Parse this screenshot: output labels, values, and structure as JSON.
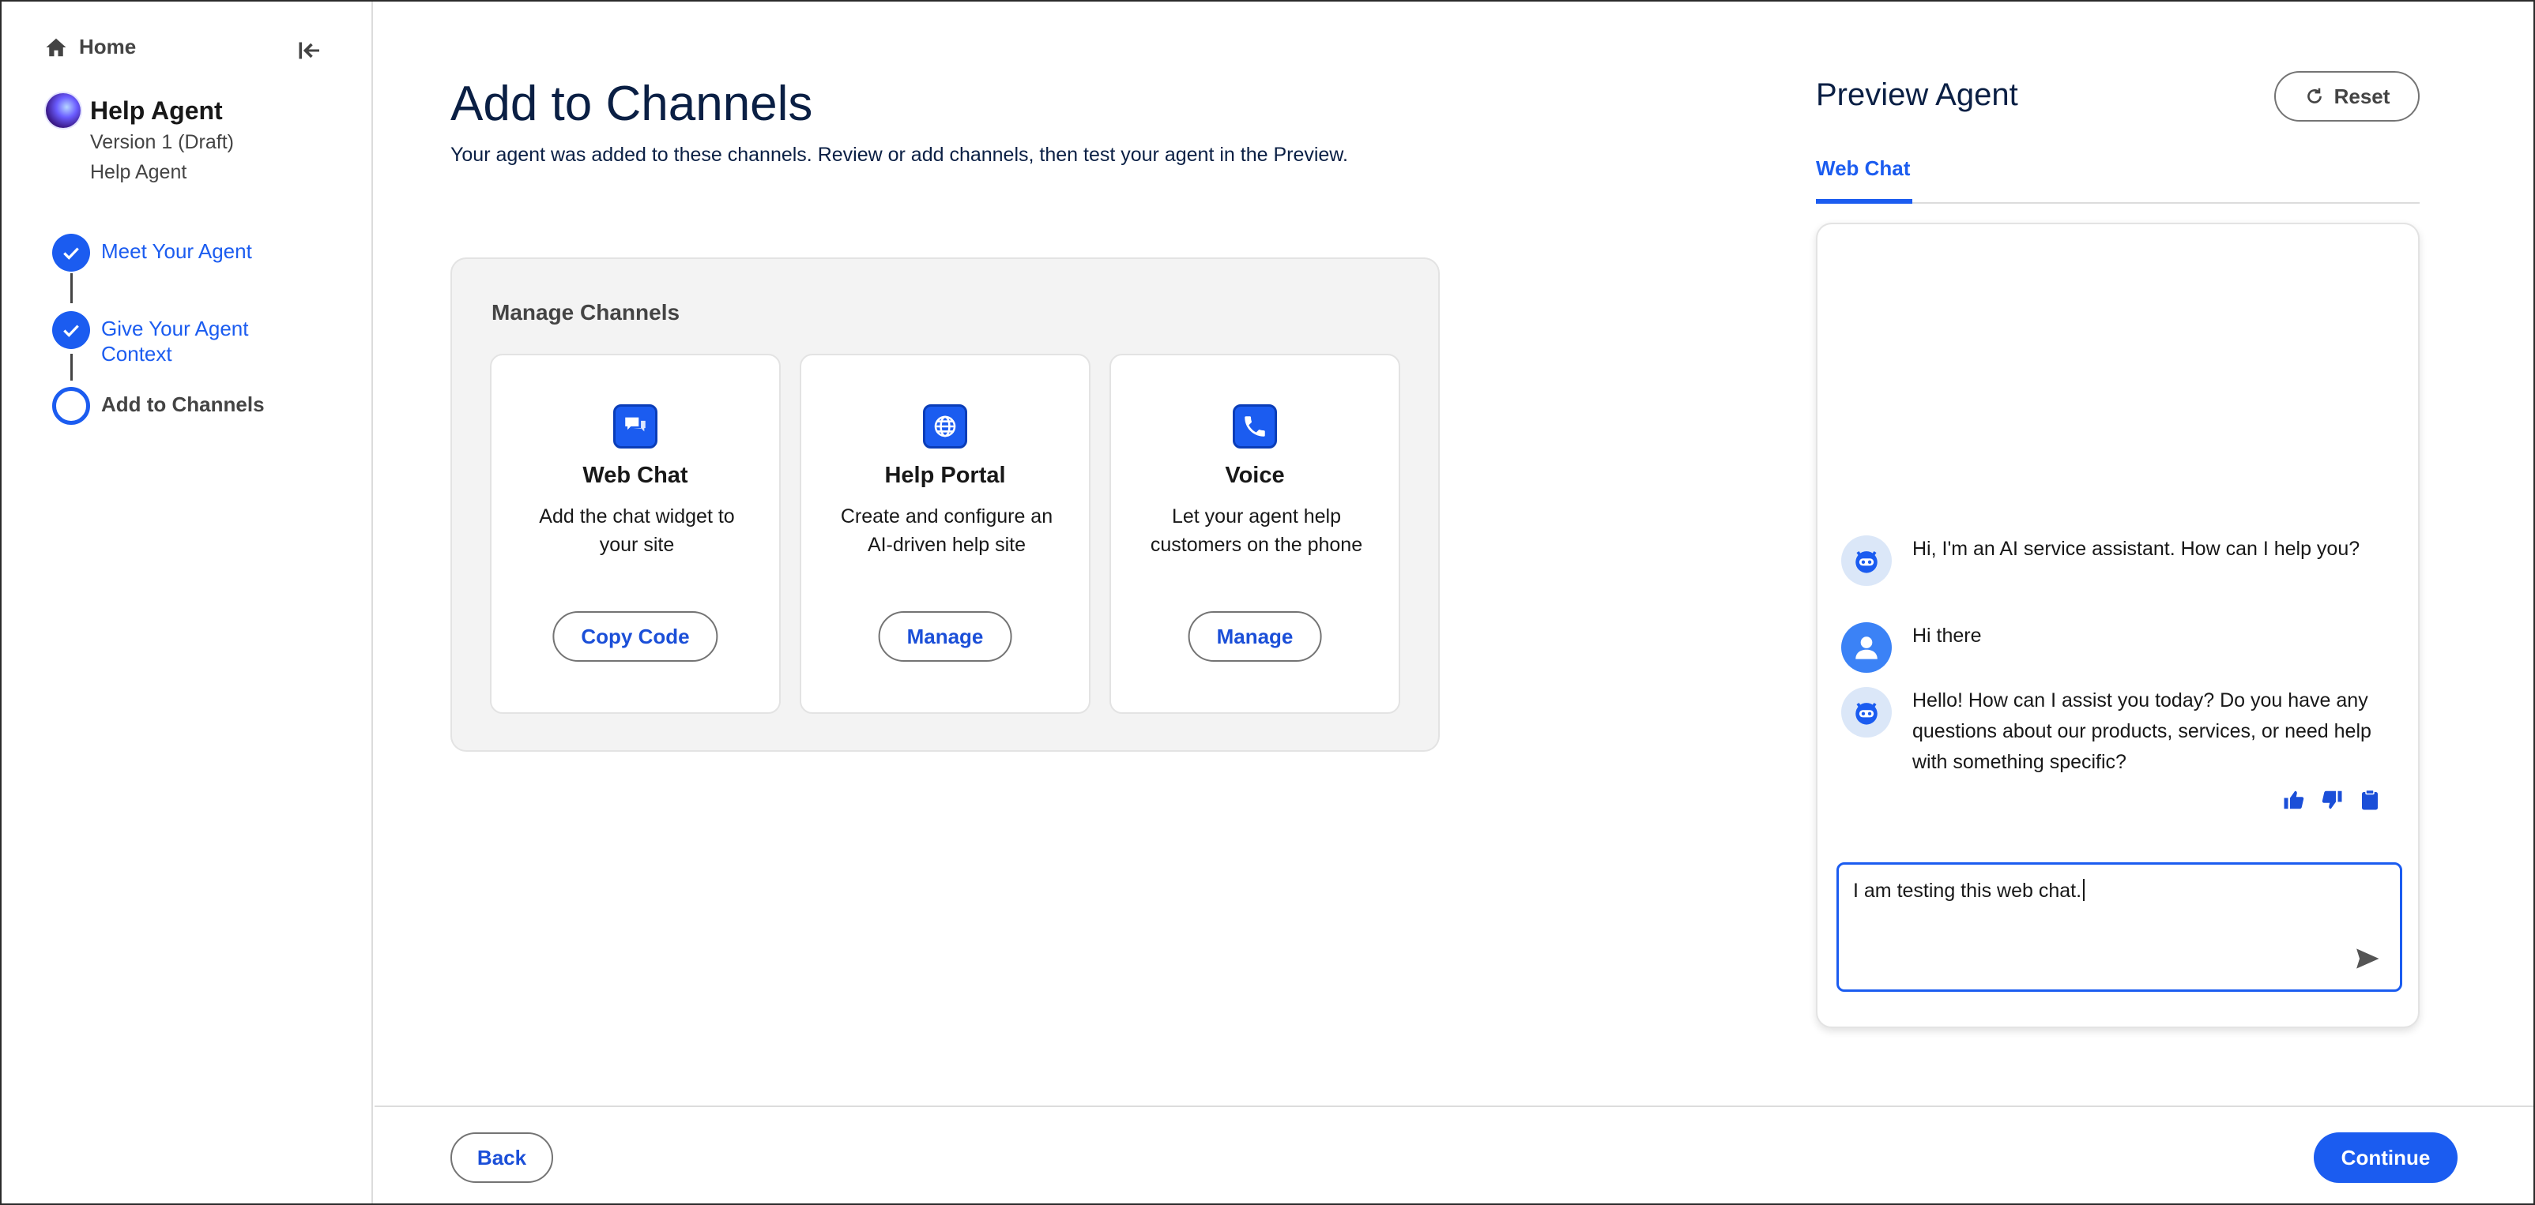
{
  "sidebar": {
    "home_label": "Home",
    "agent": {
      "name": "Help Agent",
      "version": "Version 1 (Draft)",
      "subtitle": "Help Agent"
    },
    "steps": [
      {
        "label_lines": [
          "Meet Your Agent"
        ],
        "status": "complete"
      },
      {
        "label_lines": [
          "Give Your Agent",
          "Context"
        ],
        "status": "complete"
      },
      {
        "label_lines": [
          "Add to Channels"
        ],
        "status": "current"
      }
    ]
  },
  "main": {
    "title": "Add to Channels",
    "subtitle": "Your agent was added to these channels. Review or add channels, then test your agent in the Preview.",
    "manage": {
      "title": "Manage Channels",
      "cards": [
        {
          "icon": "chat-bubble-icon",
          "title": "Web Chat",
          "description": "Add the chat widget to your site",
          "button": "Copy Code"
        },
        {
          "icon": "globe-icon",
          "title": "Help Portal",
          "description": "Create and configure an AI-driven help site",
          "button": "Manage"
        },
        {
          "icon": "phone-icon",
          "title": "Voice",
          "description": "Let your agent help customers on the phone",
          "button": "Manage"
        }
      ]
    }
  },
  "preview": {
    "title": "Preview Agent",
    "reset_label": "Reset",
    "tab_label": "Web Chat",
    "messages": [
      {
        "sender": "bot",
        "text": "Hi, I'm an AI service assistant. How can I help you?"
      },
      {
        "sender": "user",
        "text": "Hi there"
      },
      {
        "sender": "bot",
        "text": "Hello! How can I assist you today? Do you have any questions about our products, services, or need help with something specific?"
      }
    ],
    "input_value": "I am testing this web chat."
  },
  "footer": {
    "back_label": "Back",
    "continue_label": "Continue"
  },
  "colors": {
    "accent": "#1b5cf0",
    "title": "#0a1f44",
    "panel_bg": "#f3f3f3"
  }
}
